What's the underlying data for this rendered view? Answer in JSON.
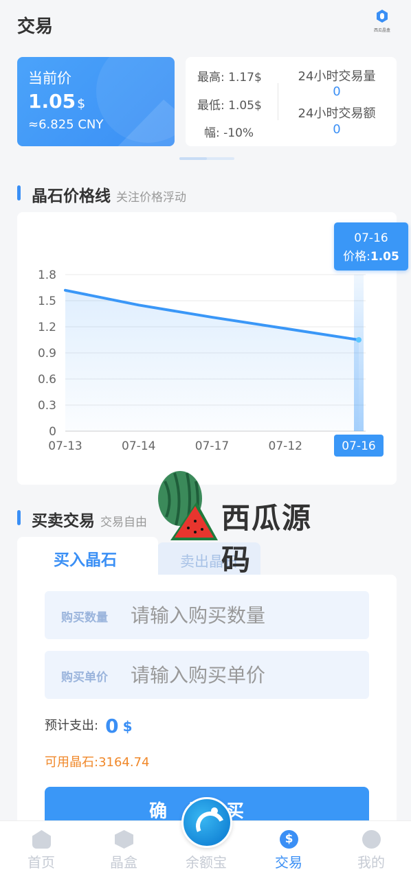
{
  "header": {
    "title": "交易",
    "logo_caption": "西瓜晶盒"
  },
  "price_card": {
    "label": "当前价",
    "value": "1.05",
    "currency": "$",
    "cny": "≈6.825 CNY"
  },
  "stats": {
    "high": "最高: 1.17$",
    "low": "最低: 1.05$",
    "change": "幅: -10%",
    "volume_label": "24小时交易量",
    "volume_value": "0",
    "amount_label": "24小时交易额",
    "amount_value": "0"
  },
  "price_section": {
    "title": "晶石价格线",
    "subtitle": "关注价格浮动"
  },
  "chart_data": {
    "type": "area",
    "title": "",
    "xlabel": "",
    "ylabel": "",
    "categories": [
      "07-13",
      "07-14",
      "07-17",
      "07-12",
      "07-16"
    ],
    "values": [
      1.62,
      1.45,
      1.31,
      1.18,
      1.05
    ],
    "ylim": [
      0,
      1.8
    ],
    "yticks": [
      "0",
      "0.3",
      "0.6",
      "0.9",
      "1.2",
      "1.5",
      "1.8"
    ],
    "grid": true,
    "highlight_index": 4,
    "tooltip": {
      "date": "07-16",
      "label": "价格:",
      "value": "1.05"
    },
    "color": "#3a97f7"
  },
  "watermark": {
    "text": "西瓜源码"
  },
  "trade_section": {
    "title": "买卖交易",
    "subtitle": "交易自由"
  },
  "trade": {
    "tab_buy": "买入晶石",
    "tab_sell": "卖出晶石",
    "qty_label": "购买数量",
    "qty_placeholder": "请输入购买数量",
    "price_label": "购买单价",
    "price_placeholder": "请输入购买单价",
    "est_label": "预计支出:",
    "est_value": "0",
    "est_currency": "$",
    "available": "可用晶石:3164.74",
    "confirm": "确认买"
  },
  "tabbar": {
    "items": [
      {
        "label": "首页",
        "icon": "home-icon"
      },
      {
        "label": "晶盒",
        "icon": "box-icon"
      },
      {
        "label": "余额宝",
        "icon": "balance-icon"
      },
      {
        "label": "交易",
        "icon": "dollar-icon"
      },
      {
        "label": "我的",
        "icon": "user-icon"
      }
    ],
    "active": 3
  }
}
